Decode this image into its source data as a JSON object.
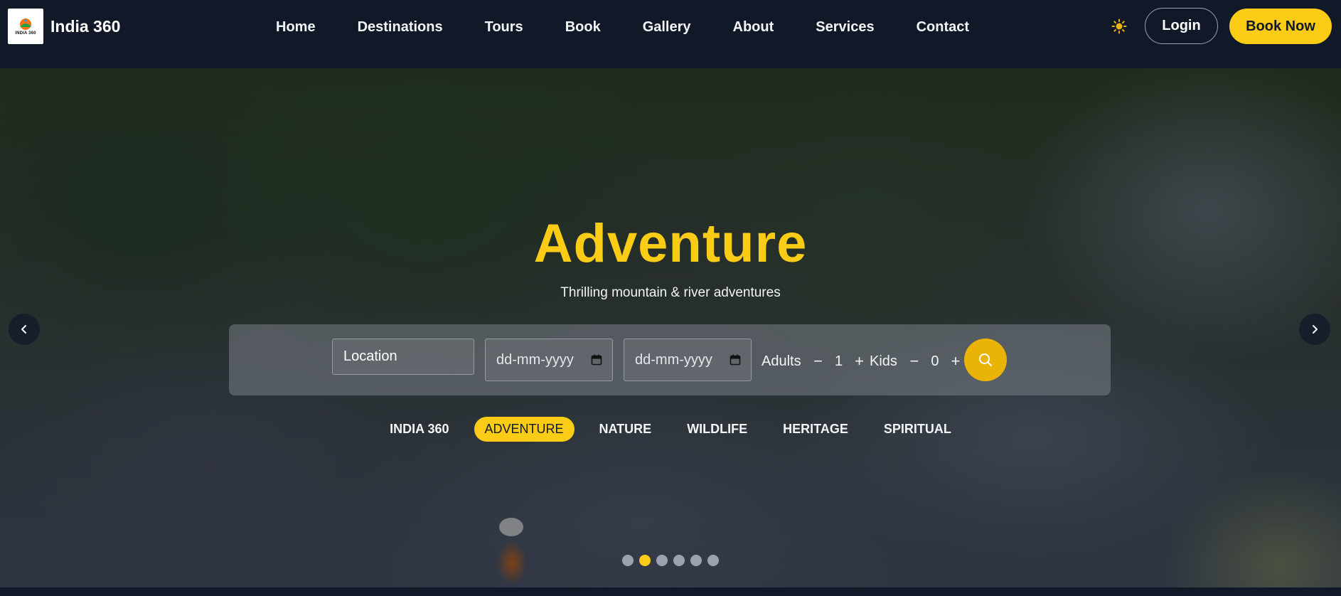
{
  "brand": {
    "logo_text": "INDIA 360",
    "name": "India 360"
  },
  "nav": {
    "links": [
      "Home",
      "Destinations",
      "Tours",
      "Book",
      "Gallery",
      "About",
      "Services",
      "Contact"
    ],
    "theme_icon": "sun-icon",
    "login_label": "Login",
    "book_now_label": "Book Now"
  },
  "hero": {
    "title": "Adventure",
    "subtitle": "Thrilling mountain & river adventures",
    "prev_icon": "chevron-left-icon",
    "next_icon": "chevron-right-icon"
  },
  "search": {
    "location_placeholder": "Location",
    "checkin_placeholder": "dd-mm-yyyy",
    "checkout_placeholder": "dd-mm-yyyy",
    "adults_label": "Adults",
    "adults_value": "1",
    "kids_label": "Kids",
    "kids_value": "0",
    "minus_symbol": "−",
    "plus_symbol": "+",
    "search_icon": "search-icon"
  },
  "tabs": {
    "items": [
      "INDIA 360",
      "ADVENTURE",
      "NATURE",
      "WILDLIFE",
      "HERITAGE",
      "SPIRITUAL"
    ],
    "active_index": 1
  },
  "carousel": {
    "slide_count": 6,
    "active_index": 1
  },
  "colors": {
    "accent": "#facc15",
    "nav_bg": "#111827"
  }
}
